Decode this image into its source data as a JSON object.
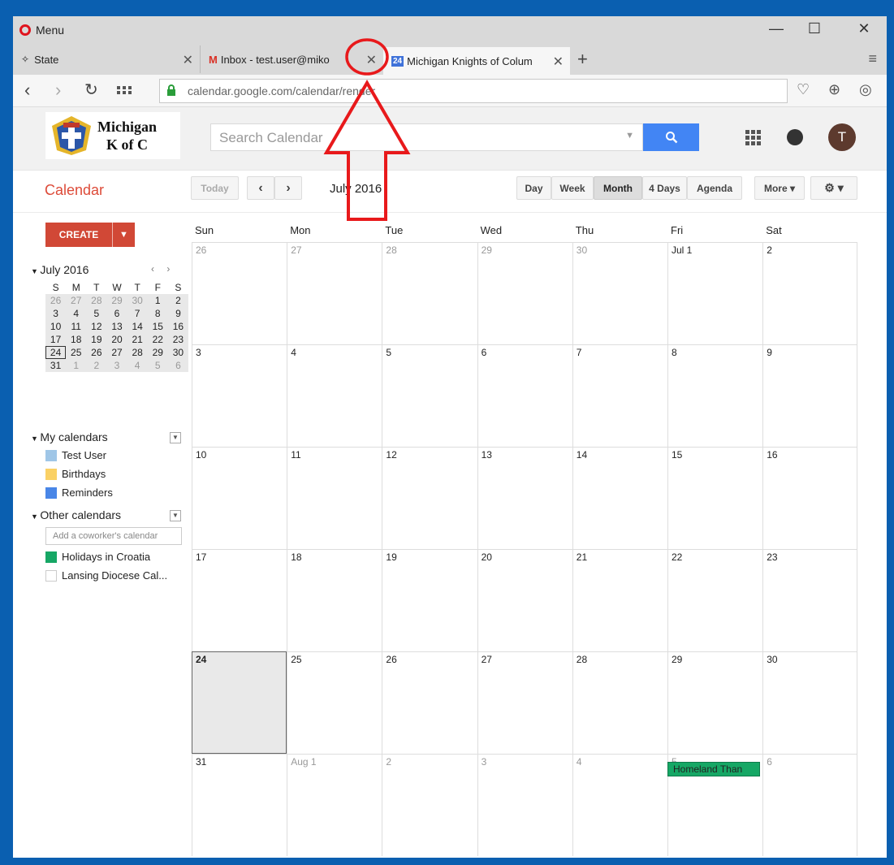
{
  "browser": {
    "menu_label": "Menu",
    "tabs": [
      {
        "label": "State"
      },
      {
        "label": "Inbox - test.user@miko"
      },
      {
        "favicon_text": "24",
        "label": "Michigan Knights of Colum"
      }
    ],
    "url": "calendar.google.com/calendar/render",
    "colors": {
      "opera_red": "#e0141e",
      "window_frame": "#0a5fb0"
    }
  },
  "header": {
    "logo_line1": "Michigan",
    "logo_line2": "K of C",
    "search_placeholder": "Search Calendar",
    "avatar_initial": "T",
    "colors": {
      "search_button": "#4285f4"
    }
  },
  "toolbar": {
    "title": "Calendar",
    "today_label": "Today",
    "date_range": "July 2016",
    "views": [
      "Day",
      "Week",
      "Month",
      "4 Days",
      "Agenda"
    ],
    "active_view": "Month",
    "more_label": "More ▾"
  },
  "sidebar": {
    "create_label": "CREATE",
    "mini_month_title": "July 2016",
    "mini_headers": [
      "S",
      "M",
      "T",
      "W",
      "T",
      "F",
      "S"
    ],
    "mini_weeks": [
      [
        "26",
        "27",
        "28",
        "29",
        "30",
        "1",
        "2"
      ],
      [
        "3",
        "4",
        "5",
        "6",
        "7",
        "8",
        "9"
      ],
      [
        "10",
        "11",
        "12",
        "13",
        "14",
        "15",
        "16"
      ],
      [
        "17",
        "18",
        "19",
        "20",
        "21",
        "22",
        "23"
      ],
      [
        "24",
        "25",
        "26",
        "27",
        "28",
        "29",
        "30"
      ],
      [
        "31",
        "1",
        "2",
        "3",
        "4",
        "5",
        "6"
      ]
    ],
    "my_calendars_title": "My calendars",
    "my_calendars": [
      {
        "name": "Test User",
        "color": "#9fc6e7"
      },
      {
        "name": "Birthdays",
        "color": "#fad165"
      },
      {
        "name": "Reminders",
        "color": "#4986e7"
      }
    ],
    "other_calendars_title": "Other calendars",
    "coworker_placeholder": "Add a coworker's calendar",
    "other_calendars": [
      {
        "name": "Holidays in Croatia",
        "color": "#16a765"
      },
      {
        "name": "Lansing Diocese Cal...",
        "color": "#ffffff"
      }
    ]
  },
  "month": {
    "weekdays": [
      "Sun",
      "Mon",
      "Tue",
      "Wed",
      "Thu",
      "Fri",
      "Sat"
    ],
    "weeks": [
      [
        "26",
        "27",
        "28",
        "29",
        "30",
        "Jul 1",
        "2"
      ],
      [
        "3",
        "4",
        "5",
        "6",
        "7",
        "8",
        "9"
      ],
      [
        "10",
        "11",
        "12",
        "13",
        "14",
        "15",
        "16"
      ],
      [
        "17",
        "18",
        "19",
        "20",
        "21",
        "22",
        "23"
      ],
      [
        "24",
        "25",
        "26",
        "27",
        "28",
        "29",
        "30"
      ],
      [
        "31",
        "Aug 1",
        "2",
        "3",
        "4",
        "5",
        "6"
      ]
    ],
    "event_label": "Homeland Than",
    "event_color": "#16a765"
  }
}
